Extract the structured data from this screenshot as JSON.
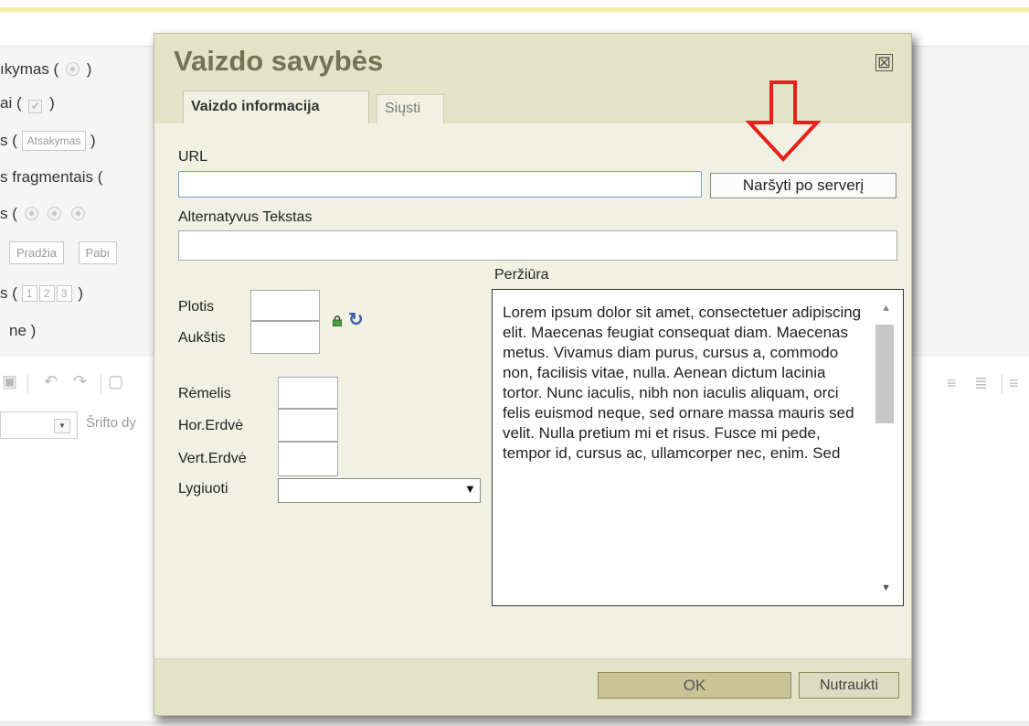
{
  "background_editor": {
    "lines": [
      {
        "text": "ıkymas (",
        "suffix": ")"
      },
      {
        "text": "ai (",
        "suffix": ")"
      },
      {
        "text": "s (",
        "chip": "Atsakymas",
        "suffix": ")"
      },
      {
        "text": "s fragmentais ("
      },
      {
        "text": "s ("
      },
      {
        "chips": [
          "Pradžia",
          "Pabı"
        ]
      },
      {
        "text": "s (",
        "nums": [
          "1",
          "2",
          "3"
        ],
        "suffix": ")"
      },
      {
        "text": "ne )"
      }
    ],
    "font_label": "Šrifto dy",
    "colors": {
      "top_stripe": "#f8eba5",
      "panel": "#f5f5f5"
    }
  },
  "dialog": {
    "title": "Vaizdo savybės",
    "close_glyph": "⊠",
    "tabs": [
      {
        "label": "Vaizdo informacija",
        "active": true
      },
      {
        "label": "Siųsti",
        "active": false
      }
    ],
    "url_label": "URL",
    "url_value": "",
    "browse_button": "Naršyti po serverį",
    "alt_label": "Alternatyvus Tekstas",
    "alt_value": "",
    "width_label": "Plotis",
    "height_label": "Aukštis",
    "border_label": "Rėmelis",
    "hspace_label": "Hor.Erdvė",
    "vspace_label": "Vert.Erdvė",
    "align_label": "Lygiuoti",
    "align_value": "",
    "preview_label": "Peržiūra",
    "preview_text": "Lorem ipsum dolor sit amet, consectetuer adipiscing elit. Maecenas feugiat consequat diam. Maecenas metus. Vivamus diam purus, cursus a, commodo non, facilisis vitae, nulla. Aenean dictum lacinia tortor. Nunc iaculis, nibh non iaculis aliquam, orci felis euismod neque, sed ornare massa mauris sed velit. Nulla pretium mi et risus. Fusce mi pede, tempor id, cursus ac, ullamcorper nec, enim. Sed",
    "ok_button": "OK",
    "cancel_button": "Nutraukti",
    "colors": {
      "header": "#e3e3c7",
      "body": "#f1f1e3",
      "title": "#737357",
      "ok": "#c9c395",
      "annotation_arrow": "#e8201c"
    }
  }
}
